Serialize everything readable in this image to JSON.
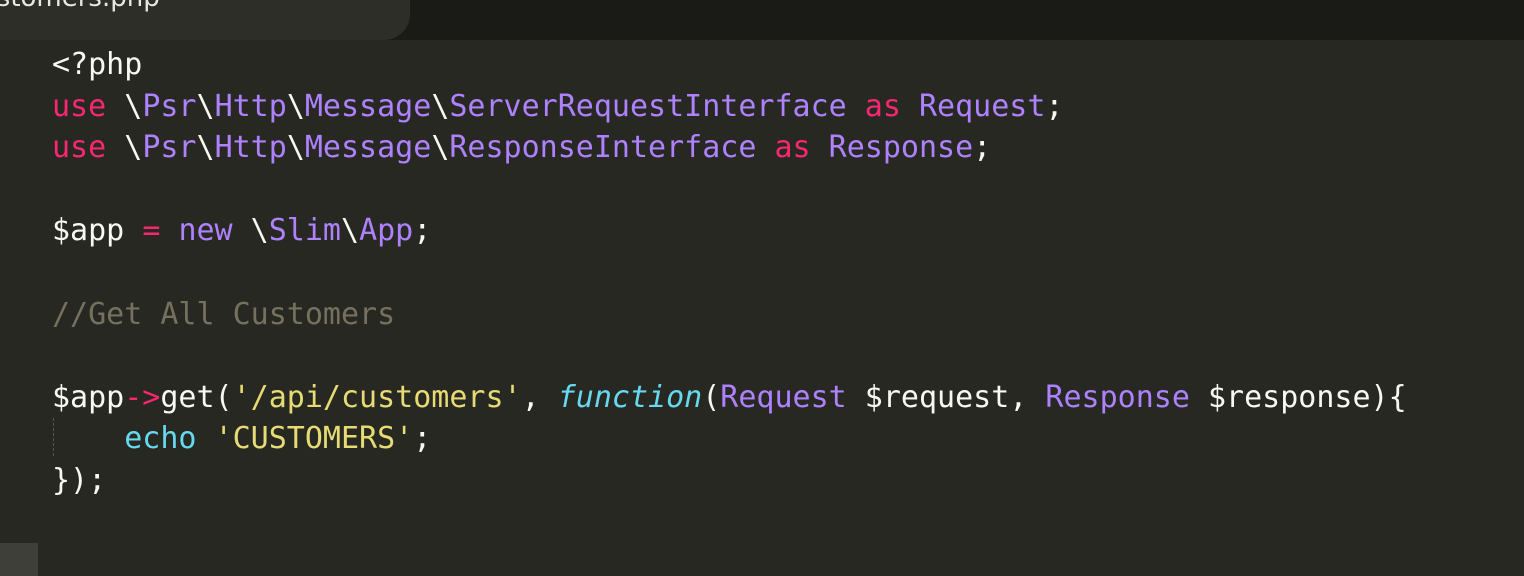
{
  "tab": {
    "title": "customers.php",
    "close_glyph": "×"
  },
  "colors": {
    "background": "#272822",
    "keyword": "#f92672",
    "class_name": "#ae81ff",
    "string": "#e6db74",
    "function": "#66d9ef",
    "comment": "#75715e",
    "text": "#f8f8f2"
  },
  "code": {
    "lines": [
      [
        {
          "t": "<?php",
          "c": "tok-plain"
        }
      ],
      [
        {
          "t": "use",
          "c": "tok-keyword"
        },
        {
          "t": " \\",
          "c": "tok-plain"
        },
        {
          "t": "Psr",
          "c": "tok-class"
        },
        {
          "t": "\\",
          "c": "tok-plain"
        },
        {
          "t": "Http",
          "c": "tok-class"
        },
        {
          "t": "\\",
          "c": "tok-plain"
        },
        {
          "t": "Message",
          "c": "tok-class"
        },
        {
          "t": "\\",
          "c": "tok-plain"
        },
        {
          "t": "ServerRequestInterface",
          "c": "tok-class"
        },
        {
          "t": " ",
          "c": "tok-plain"
        },
        {
          "t": "as",
          "c": "tok-keyword"
        },
        {
          "t": " ",
          "c": "tok-plain"
        },
        {
          "t": "Request",
          "c": "tok-class"
        },
        {
          "t": ";",
          "c": "tok-plain"
        }
      ],
      [
        {
          "t": "use",
          "c": "tok-keyword"
        },
        {
          "t": " \\",
          "c": "tok-plain"
        },
        {
          "t": "Psr",
          "c": "tok-class"
        },
        {
          "t": "\\",
          "c": "tok-plain"
        },
        {
          "t": "Http",
          "c": "tok-class"
        },
        {
          "t": "\\",
          "c": "tok-plain"
        },
        {
          "t": "Message",
          "c": "tok-class"
        },
        {
          "t": "\\",
          "c": "tok-plain"
        },
        {
          "t": "ResponseInterface",
          "c": "tok-class"
        },
        {
          "t": " ",
          "c": "tok-plain"
        },
        {
          "t": "as",
          "c": "tok-keyword"
        },
        {
          "t": " ",
          "c": "tok-plain"
        },
        {
          "t": "Response",
          "c": "tok-class"
        },
        {
          "t": ";",
          "c": "tok-plain"
        }
      ],
      [],
      [
        {
          "t": "$app",
          "c": "tok-var"
        },
        {
          "t": " ",
          "c": "tok-plain"
        },
        {
          "t": "=",
          "c": "tok-keyword"
        },
        {
          "t": " ",
          "c": "tok-plain"
        },
        {
          "t": "new",
          "c": "tok-class"
        },
        {
          "t": " \\",
          "c": "tok-plain"
        },
        {
          "t": "Slim",
          "c": "tok-class"
        },
        {
          "t": "\\",
          "c": "tok-plain"
        },
        {
          "t": "App",
          "c": "tok-class"
        },
        {
          "t": ";",
          "c": "tok-plain"
        }
      ],
      [],
      [
        {
          "t": "//Get All Customers",
          "c": "tok-comment"
        }
      ],
      [],
      [
        {
          "t": "$app",
          "c": "tok-var"
        },
        {
          "t": "->",
          "c": "tok-keyword"
        },
        {
          "t": "get(",
          "c": "tok-plain"
        },
        {
          "t": "'/api/customers'",
          "c": "tok-string"
        },
        {
          "t": ", ",
          "c": "tok-plain"
        },
        {
          "t": "function",
          "c": "tok-function"
        },
        {
          "t": "(",
          "c": "tok-plain"
        },
        {
          "t": "Request",
          "c": "tok-class"
        },
        {
          "t": " $request, ",
          "c": "tok-plain"
        },
        {
          "t": "Response",
          "c": "tok-class"
        },
        {
          "t": " $response){",
          "c": "tok-plain"
        }
      ],
      [
        {
          "t": "    ",
          "c": "tok-plain"
        },
        {
          "t": "echo",
          "c": "tok-builtin"
        },
        {
          "t": " ",
          "c": "tok-plain"
        },
        {
          "t": "'CUSTOMERS'",
          "c": "tok-string"
        },
        {
          "t": ";",
          "c": "tok-plain"
        }
      ],
      [
        {
          "t": "});",
          "c": "tok-plain"
        }
      ],
      []
    ]
  }
}
